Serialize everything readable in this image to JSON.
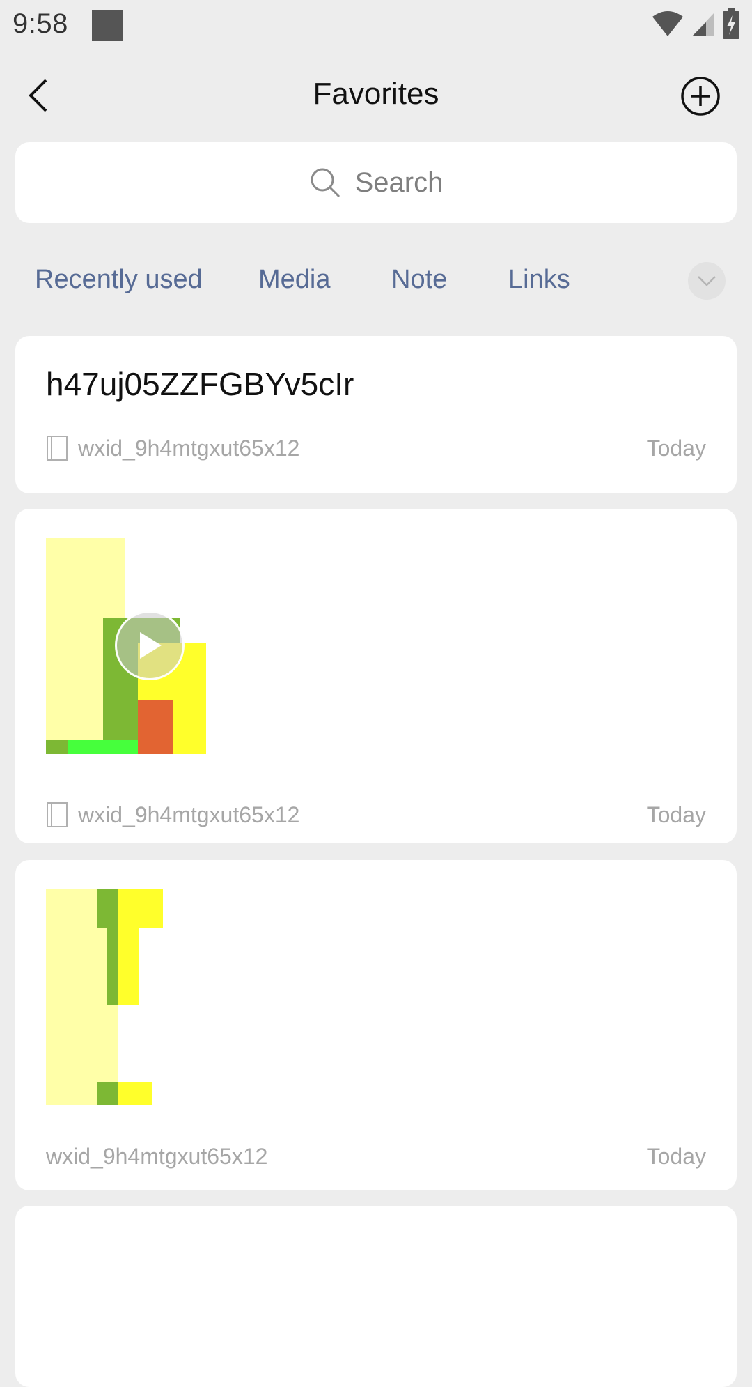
{
  "status_bar": {
    "time": "9:58"
  },
  "header": {
    "title": "Favorites"
  },
  "search": {
    "placeholder": "Search"
  },
  "tabs": [
    {
      "label": "Recently used"
    },
    {
      "label": "Media"
    },
    {
      "label": "Note"
    },
    {
      "label": "Links"
    }
  ],
  "cards": [
    {
      "type": "text",
      "title": "h47uj05ZZFGBYv5cIr",
      "source": "wxid_9h4mtgxut65x12",
      "date": "Today",
      "source_icon": "book-icon"
    },
    {
      "type": "video",
      "source": "wxid_9h4mtgxut65x12",
      "date": "Today",
      "source_icon": "book-icon"
    },
    {
      "type": "image",
      "source": "wxid_9h4mtgxut65x12",
      "date": "Today"
    }
  ],
  "colors": {
    "link": "#576b95",
    "background": "#ededed",
    "card": "#ffffff",
    "muted_text": "#a6a6a6"
  }
}
